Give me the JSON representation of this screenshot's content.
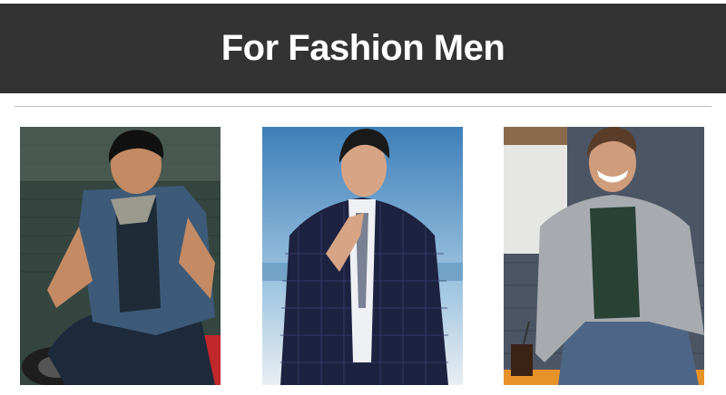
{
  "header": {
    "title": "For Fashion Men"
  },
  "gallery": {
    "items": [
      {
        "icon": "model-denim-vest-photo"
      },
      {
        "icon": "model-plaid-suit-photo"
      },
      {
        "icon": "model-grey-blazer-photo"
      }
    ]
  },
  "colors": {
    "banner_bg": "#333333",
    "banner_text": "#ffffff",
    "divider": "#bdbdbd"
  }
}
